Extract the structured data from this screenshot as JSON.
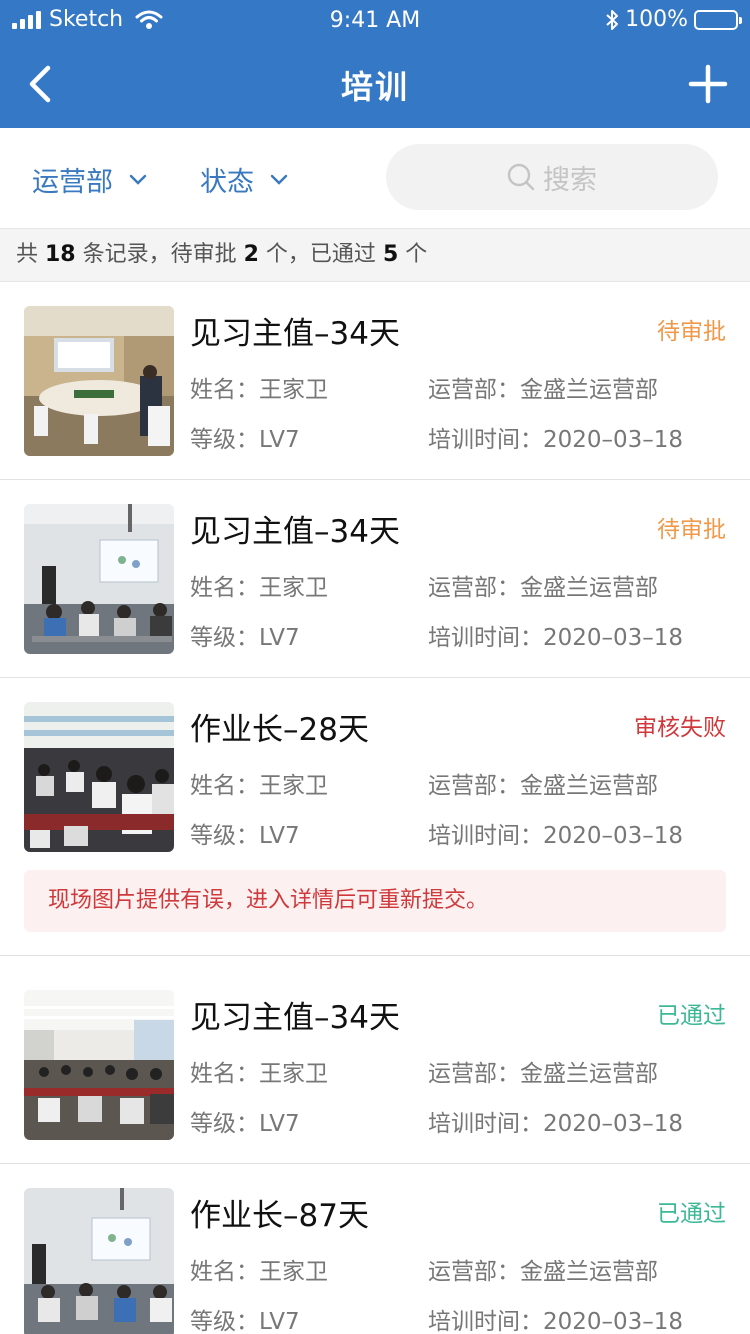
{
  "status_bar": {
    "carrier": "Sketch",
    "time": "9:41 AM",
    "battery": "100%"
  },
  "nav": {
    "title": "培训"
  },
  "filters": {
    "dept": "运营部",
    "status": "状态",
    "search_placeholder": "搜索"
  },
  "summary": {
    "p1": "共 ",
    "total": "18",
    "p2": " 条记录，待审批 ",
    "pending": "2",
    "p3": " 个，已通过 ",
    "passed": "5",
    "p4": " 个"
  },
  "labels": {
    "name": "姓名：",
    "dept": "运营部：",
    "level": "等级：",
    "date": "培训时间："
  },
  "colors": {
    "primary": "#3578c5",
    "pending": "#f0994a",
    "failed": "#d0393b",
    "passed": "#3cb896",
    "note_bg": "#fdf0f0"
  },
  "items": [
    {
      "title": "见习主值–34天",
      "status": "待审批",
      "name": "王家卫",
      "dept": "金盛兰运营部",
      "level": "LV7",
      "date": "2020–03–18"
    },
    {
      "title": "见习主值–34天",
      "status": "待审批",
      "name": "王家卫",
      "dept": "金盛兰运营部",
      "level": "LV7",
      "date": "2020–03–18"
    },
    {
      "title": "作业长–28天",
      "status": "审核失败",
      "name": "王家卫",
      "dept": "金盛兰运营部",
      "level": "LV7",
      "date": "2020–03–18",
      "note": "现场图片提供有误，进入详情后可重新提交。"
    },
    {
      "title": "见习主值–34天",
      "status": "已通过",
      "name": "王家卫",
      "dept": "金盛兰运营部",
      "level": "LV7",
      "date": "2020–03–18"
    },
    {
      "title": "作业长–87天",
      "status": "已通过",
      "name": "王家卫",
      "dept": "金盛兰运营部",
      "level": "LV7",
      "date": "2020–03–18"
    }
  ]
}
